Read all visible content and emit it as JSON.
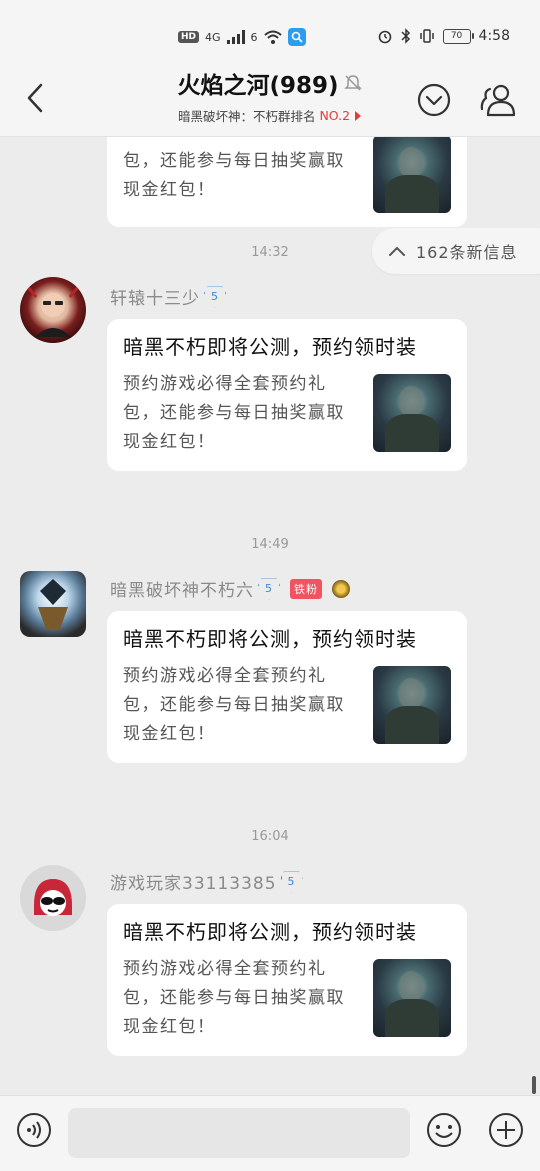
{
  "status_bar": {
    "hd": "HD",
    "net1": "4G",
    "net2": "6",
    "battery": "70",
    "time": "4:58"
  },
  "header": {
    "title": "火焰之河(989)",
    "subtitle_prefix": "暗黑破坏神：不朽群排名",
    "rank": "NO.2"
  },
  "new_messages": {
    "label": "162条新信息"
  },
  "messages": [
    {
      "time": "",
      "sender": "",
      "title": "",
      "desc": "包，还能参与每日抽奖赢取现金红包！"
    },
    {
      "time": "14:32",
      "sender": "轩辕十三少",
      "level": "5",
      "title": "暗黑不朽即将公测，预约领时装",
      "desc": "预约游戏必得全套预约礼包，还能参与每日抽奖赢取现金红包！"
    },
    {
      "time": "14:49",
      "sender": "暗黑破坏神不朽六",
      "level": "5",
      "tag": "铁粉",
      "title": "暗黑不朽即将公测，预约领时装",
      "desc": "预约游戏必得全套预约礼包，还能参与每日抽奖赢取现金红包！"
    },
    {
      "time": "16:04",
      "sender": "游戏玩家33113385",
      "level": "5",
      "title": "暗黑不朽即将公测，预约领时装",
      "desc": "预约游戏必得全套预约礼包，还能参与每日抽奖赢取现金红包！"
    }
  ],
  "input": {
    "placeholder": ""
  },
  "colors": {
    "background": "#ececec",
    "bubble": "#ffffff",
    "accent_red": "#e23b3b",
    "level_blue": "#3d86d8"
  }
}
